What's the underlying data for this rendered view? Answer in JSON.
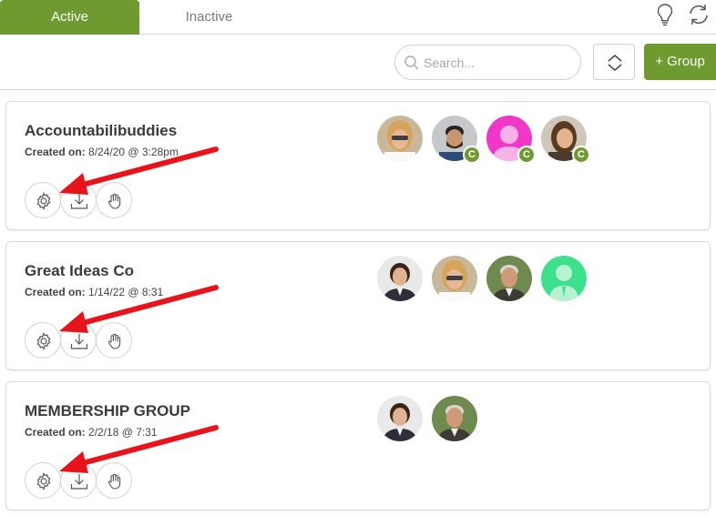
{
  "tabs": {
    "active": "Active",
    "inactive": "Inactive"
  },
  "toolbar": {
    "search_placeholder": "Search...",
    "add_group_label": "+ Group"
  },
  "colors": {
    "brand": "#6e9a2f",
    "arrow": "#e8141b"
  },
  "groups": [
    {
      "name": "Accountabilibuddies",
      "created_label": "Created on:",
      "created_value": "8/24/20 @ 3:28pm",
      "members": [
        {
          "avatar": "woman-sunglasses-photo",
          "badge": ""
        },
        {
          "avatar": "man-beard-photo",
          "badge": "C"
        },
        {
          "avatar": "default-pink-avatar",
          "badge": "C"
        },
        {
          "avatar": "woman-smiling-photo",
          "badge": "C"
        }
      ]
    },
    {
      "name": "Great Ideas Co",
      "created_label": "Created on:",
      "created_value": "1/14/22 @ 8:31",
      "members": [
        {
          "avatar": "woman-suit-photo",
          "badge": ""
        },
        {
          "avatar": "woman-sunglasses-photo",
          "badge": ""
        },
        {
          "avatar": "older-man-photo",
          "badge": ""
        },
        {
          "avatar": "default-green-avatar",
          "badge": ""
        }
      ]
    },
    {
      "name": "MEMBERSHIP GROUP",
      "created_label": "Created on:",
      "created_value": "2/2/18 @ 7:31",
      "members": [
        {
          "avatar": "woman-suit-photo",
          "badge": ""
        },
        {
          "avatar": "older-man-photo",
          "badge": ""
        }
      ]
    }
  ]
}
